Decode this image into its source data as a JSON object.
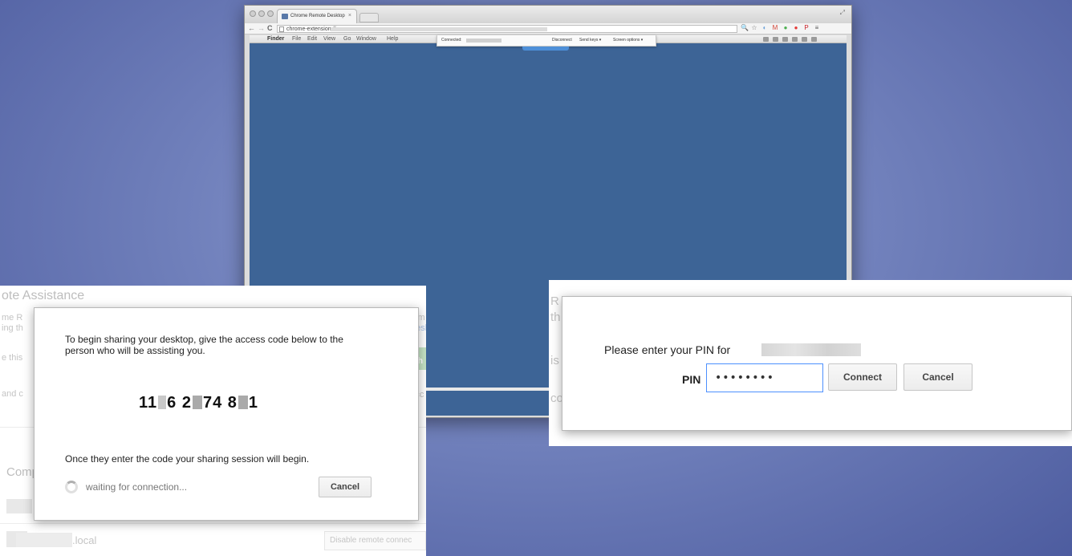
{
  "browser": {
    "tab_title": "Chrome Remote Desktop",
    "tab_close": "×",
    "url": "chrome-extension://",
    "nav": {
      "back": "←",
      "forward": "→",
      "reload": "C"
    },
    "ext_icons": [
      {
        "name": "search-icon",
        "glyph": "🔍",
        "color": "#555555"
      },
      {
        "name": "star-icon",
        "glyph": "☆",
        "color": "#777777"
      },
      {
        "name": "extension-icon",
        "glyph": "◐",
        "color": "#6aa0d8"
      },
      {
        "name": "gmail-icon",
        "glyph": "M",
        "color": "#d44638"
      },
      {
        "name": "green-ext-icon",
        "glyph": "●",
        "color": "#4caf50"
      },
      {
        "name": "red-ext-icon",
        "glyph": "●",
        "color": "#e53935"
      },
      {
        "name": "pinterest-icon",
        "glyph": "P",
        "color": "#cb2027"
      },
      {
        "name": "menu-icon",
        "glyph": "≡",
        "color": "#555555"
      }
    ]
  },
  "remote": {
    "apple": "",
    "menubar": [
      "Finder",
      "File",
      "Edit",
      "View",
      "Go",
      "Window",
      "Help"
    ],
    "connected_label": "Connected:",
    "disconnect": "Disconnect",
    "send_keys": "Send keys",
    "screen_options": "Screen options",
    "dropdown_arrow": "▾",
    "desktop_color": "#3d6496"
  },
  "left_panel": {
    "bg_title": "ote Assistance",
    "bg_lines": [
      "me R",
      "ing th",
      "e this",
      "and c"
    ],
    "bg_right_snippets": [
      "s m",
      "desk"
    ],
    "bg_green_label": "Sh",
    "bg_acc": "Acc",
    "bg_section": "Comp",
    "bg_host": ".local",
    "bg_disable_btn": "Disable remote connec",
    "dialog": {
      "intro": "To begin sharing your desktop, give the access code below to the person who will be assisting you.",
      "code_groups": [
        "11",
        "6 2",
        "74 8",
        "1"
      ],
      "after": "Once they enter the code your sharing session will begin.",
      "waiting": "waiting for connection...",
      "cancel": "Cancel"
    }
  },
  "right_panel": {
    "bg_letters": [
      "R",
      "th",
      "is",
      "co"
    ],
    "dialog": {
      "prompt": "Please enter your PIN for",
      "pin_label": "PIN",
      "pin_value": "••••••••",
      "connect": "Connect",
      "cancel": "Cancel"
    }
  }
}
